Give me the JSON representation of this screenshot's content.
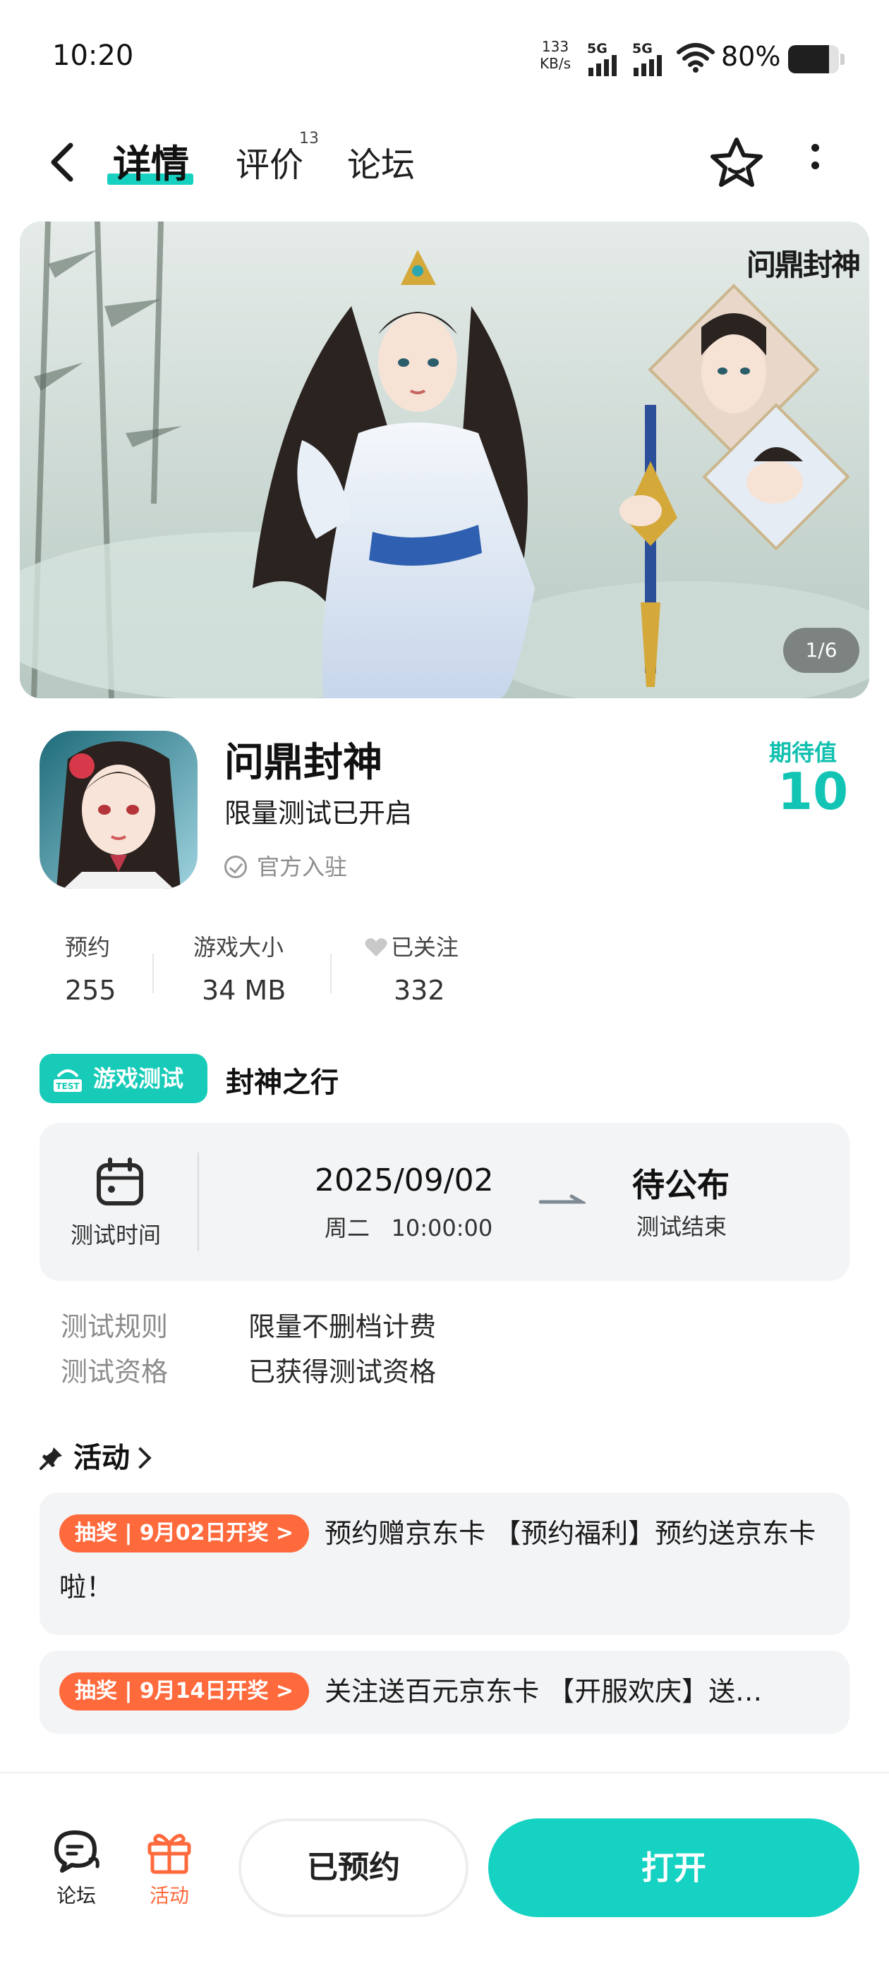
{
  "status_bar": {
    "time": "10:20",
    "net_speed_value": "133",
    "net_speed_unit": "KB/s",
    "signal1": "5G",
    "signal2": "5G",
    "battery_percent": "80%",
    "battery_level": 0.8
  },
  "nav": {
    "tabs": [
      {
        "label": "详情"
      },
      {
        "label": "评价",
        "count": "13"
      },
      {
        "label": "论坛"
      }
    ],
    "accent_color": "#16d0c0"
  },
  "hero": {
    "logo_text": "问鼎封神",
    "counter": "1/6"
  },
  "game": {
    "name": "问鼎封神",
    "subtitle": "限量测试已开启",
    "official": "官方入驻",
    "expect_label": "期待值",
    "expect_value": "10",
    "stats": [
      {
        "label": "预约",
        "value": "255"
      },
      {
        "label": "游戏大小",
        "value": "34 MB"
      },
      {
        "label": "已关注",
        "value": "332"
      }
    ]
  },
  "test": {
    "badge": "游戏测试",
    "badge_icon_text": "TEST",
    "title": "封神之行",
    "time_label": "测试时间",
    "start_date": "2025/09/02",
    "start_weekday": "周二",
    "start_time": "10:00:00",
    "end_status": "待公布",
    "end_label": "测试结束",
    "rules": [
      {
        "key": "测试规则",
        "value": "限量不删档计费"
      },
      {
        "key": "测试资格",
        "value": "已获得测试资格"
      }
    ]
  },
  "activities": {
    "heading": "活动",
    "items": [
      {
        "tag": "抽奖 | 9月02日开奖 >",
        "text": "预约赠京东卡 【预约福利】预约送京东卡啦！"
      },
      {
        "tag": "抽奖 | 9月14日开奖 >",
        "text": "关注送百元京东卡 【开服欢庆】送…"
      }
    ]
  },
  "bottom": {
    "forum_label": "论坛",
    "activity_label": "活动",
    "reserved_label": "已预约",
    "open_label": "打开",
    "activity_color": "#ff6a3d"
  }
}
